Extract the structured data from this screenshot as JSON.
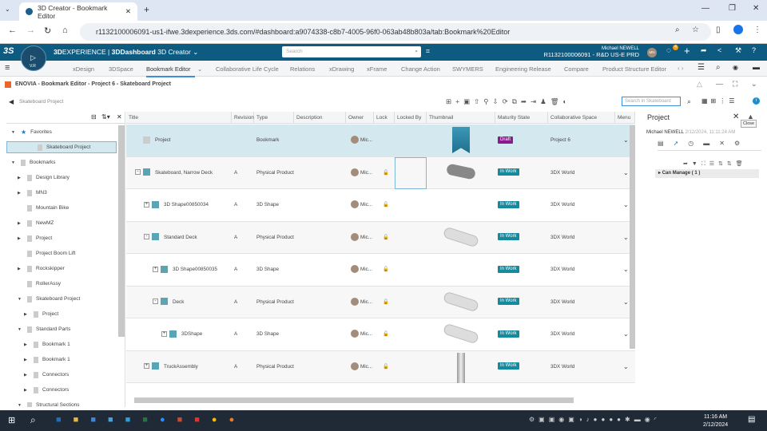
{
  "browser": {
    "tab_title": "3D Creator - Bookmark Editor",
    "url": "r1132100006091-us1-ifwe.3dexperience.3ds.com/#dashboard:a9074338-c8b7-4005-96f0-063ab48b803a/tab:Bookmark%20Editor"
  },
  "header": {
    "brand_bold": "3D",
    "brand": "EXPERIENCE | ",
    "dash": "3DDashboard",
    "app": "3D Creator",
    "search_placeholder": "Search",
    "user": "Michael NEWELL",
    "tenant": "R1132100006091 - R&D US-E PRD",
    "initials": "MN",
    "notif_count": "4",
    "compass_labels": [
      "V.R"
    ]
  },
  "app_tabs": [
    "xDesign",
    "3DSpace",
    "Bookmark Editor",
    "Collaborative Life Cycle",
    "Relations",
    "xDrawing",
    "xFrame",
    "Change Action",
    "SWYMERS",
    "Engineering Release",
    "Compare",
    "Product Structure Editor"
  ],
  "active_tab": "Bookmark Editor",
  "widget_title": "ENOVIA - Bookmark Editor - Project 6 - Skateboard Project",
  "breadcrumb": "Skateboard Project",
  "search_placeholder": "Search in Skateboard",
  "tree": [
    {
      "label": "Favorites",
      "level": 0,
      "open": true,
      "star": true
    },
    {
      "label": "Skateboard Project",
      "level": 1,
      "selected": true
    },
    {
      "label": "Bookmarks",
      "level": 0,
      "open": true
    },
    {
      "label": "Design Library",
      "level": 1
    },
    {
      "label": "MN3",
      "level": 1
    },
    {
      "label": "Mountain Bike",
      "level": 1,
      "leaf": true
    },
    {
      "label": "NewMZ",
      "level": 1
    },
    {
      "label": "Project",
      "level": 1
    },
    {
      "label": "Project Boom Lift",
      "level": 1,
      "leaf": true
    },
    {
      "label": "Rockskipper",
      "level": 1
    },
    {
      "label": "RollerAssy",
      "level": 1,
      "leaf": true
    },
    {
      "label": "Skateboard Project",
      "level": 1,
      "open": true
    },
    {
      "label": "Project",
      "level": 2
    },
    {
      "label": "Standard Parts",
      "level": 1,
      "open": true
    },
    {
      "label": "Bookmark 1",
      "level": 2
    },
    {
      "label": "Bookmark 1",
      "level": 2
    },
    {
      "label": "Connectors",
      "level": 2
    },
    {
      "label": "Connectors",
      "level": 2
    },
    {
      "label": "Structural Sections",
      "level": 1,
      "open": true
    }
  ],
  "columns": [
    "Title",
    "Revision",
    "Type",
    "Description",
    "Owner",
    "Lock",
    "Locked By",
    "Thumbnail",
    "Maturity State",
    "Collaborative Space",
    "Menu"
  ],
  "rows": [
    {
      "title": "Project",
      "rev": "",
      "type": "Bookmark",
      "owner": "Mic...",
      "state": "Draft",
      "space": "Project 6",
      "indent": 0,
      "exp": "",
      "thumb": "bookmark"
    },
    {
      "title": "Skateboard, Narrow Deck",
      "rev": "A",
      "type": "Physical Product",
      "owner": "Mic...",
      "state": "In Work",
      "space": "3DX World",
      "indent": 0,
      "exp": "-",
      "thumb": "board"
    },
    {
      "title": "3D Shape00850034",
      "rev": "A",
      "type": "3D Shape",
      "owner": "Mic...",
      "state": "In Work",
      "space": "3DX World",
      "indent": 1,
      "exp": "+",
      "thumb": ""
    },
    {
      "title": "Standard Deck",
      "rev": "A",
      "type": "Physical Product",
      "owner": "Mic...",
      "state": "In Work",
      "space": "3DX World",
      "indent": 1,
      "exp": "-",
      "thumb": "deck"
    },
    {
      "title": "3D Shape00850035",
      "rev": "A",
      "type": "3D Shape",
      "owner": "Mic...",
      "state": "In Work",
      "space": "3DX World",
      "indent": 2,
      "exp": "+",
      "thumb": ""
    },
    {
      "title": "Deck",
      "rev": "A",
      "type": "Physical Product",
      "owner": "Mic...",
      "state": "In Work",
      "space": "3DX World",
      "indent": 2,
      "exp": "-",
      "thumb": "deck"
    },
    {
      "title": "3DShape",
      "rev": "A",
      "type": "3D Shape",
      "owner": "Mic...",
      "state": "In Work",
      "space": "3DX World",
      "indent": 3,
      "exp": "+",
      "thumb": "deck"
    },
    {
      "title": "TruckAssembly",
      "rev": "A",
      "type": "Physical Product",
      "owner": "Mic...",
      "state": "In Work",
      "space": "3DX World",
      "indent": 1,
      "exp": "+",
      "thumb": "truck"
    }
  ],
  "colors": {
    "draft": "#8b1a8f",
    "inwork": "#138a9e",
    "header": "#0e5b82",
    "selected": "#d4e8f0"
  },
  "right_panel": {
    "title": "Project",
    "meta_user": "Michael NEWELL",
    "meta_date": "2/12/2024, 11:11:24 AM",
    "tooltip": "Close",
    "section": "Can Manage ( 1 )"
  },
  "taskbar": {
    "time": "11:16 AM",
    "date": "2/12/2024"
  }
}
